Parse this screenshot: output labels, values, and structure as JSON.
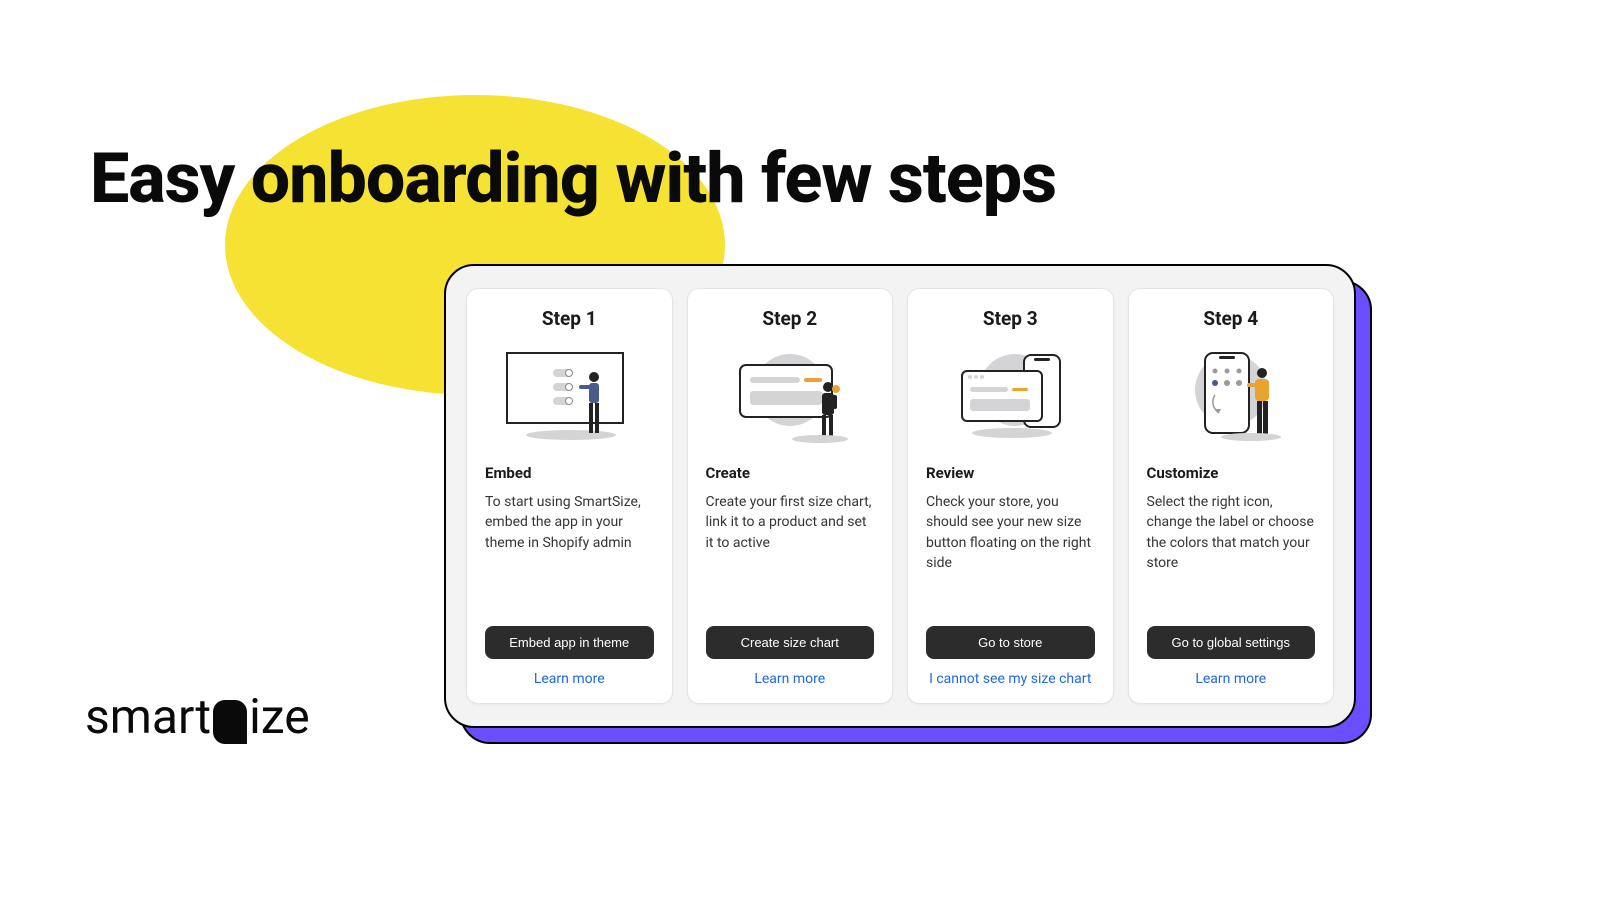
{
  "headline": "Easy onboarding with few steps",
  "logo": {
    "part1": "smart",
    "part2": "ize"
  },
  "steps": [
    {
      "label": "Step 1",
      "title": "Embed",
      "desc": "To start using SmartSize, embed the app in your theme in Shopify admin",
      "button": "Embed app in theme",
      "link": "Learn more"
    },
    {
      "label": "Step 2",
      "title": "Create",
      "desc": "Create your first size chart, link it to a product and set it to active",
      "button": "Create size chart",
      "link": "Learn more"
    },
    {
      "label": "Step 3",
      "title": "Review",
      "desc": "Check your store, you should see your new size button floating on the right side",
      "button": "Go to store",
      "link": "I cannot see my size chart"
    },
    {
      "label": "Step 4",
      "title": "Customize",
      "desc": "Select the right icon, change the label or choose the colors that match your store",
      "button": "Go to global settings",
      "link": "Learn more"
    }
  ]
}
